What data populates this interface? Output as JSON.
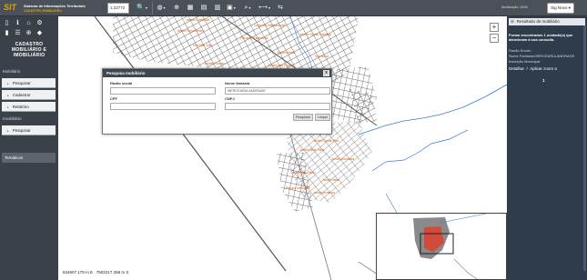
{
  "header": {
    "logo_mark": "SIT",
    "logo_line1": "Sistema de Informações Territoriais",
    "logo_line2": "CADASTRO MOBILIÁRIO",
    "scale": "1:22772",
    "last_update": "Atualização: 15/05",
    "sig_button": "Sig Novo"
  },
  "sidebar": {
    "title": "CADASTRO MOBILIÁRIO E IMOBILIÁRIO",
    "sections": [
      {
        "label": "Mobiliário",
        "items": [
          "Pesquisar",
          "Cadastrar",
          "Relatório"
        ]
      },
      {
        "label": "Imobiliário",
        "items": [
          "Pesquisar"
        ]
      }
    ],
    "tematicos": "Temáticos"
  },
  "dialog": {
    "title": "Pesquisa mobiliário",
    "close": "x",
    "labels": {
      "razao": "Razão social",
      "fantasia": "Nome fantasia",
      "cpf": "CPF",
      "cnpj": "CNPJ"
    },
    "values": {
      "razao": "",
      "fantasia": "MERCEARIA ANDRADE",
      "cpf": "",
      "cnpj": ""
    },
    "buttons": {
      "search": "Pesquisar",
      "clear": "Limpar"
    }
  },
  "map": {
    "coords_x": "634607.179 m E",
    "coords_y": "7502217.268 m S",
    "zoom_in": "+",
    "zoom_out": "−",
    "labels": [
      "Jardim Califórnia",
      "Conjunto Habitacional",
      "Jardim Rosa Muller",
      "Jardim Santa Cândida",
      "Parque Residencial",
      "Vila São José",
      "Jardim Brasil",
      "Vila Nova",
      "Jardim Paraíso",
      "Jardim das Flores",
      "Jardim Morumbi",
      "Jardim Santa Rita",
      "Jardim Bela Vista",
      "Jardim Alvorada",
      "Jardim São Paulo",
      "Jardim Itália",
      "Parque Industrial",
      "Jardim América"
    ],
    "colors": {
      "streets": "#6b6b6b",
      "labels": "#e05a00",
      "river": "#3a7bd5",
      "highlight": "#d24a3a"
    }
  },
  "results": {
    "title": "Resultado de mobiliário",
    "found": "Foram encontrados 1 unidade(s) que atenderam à sua consulta.",
    "razao": "Razão Social:",
    "fantasia": "Nome Fantasia:MERCEARIA ANDRADE",
    "inscricao": "Inscrição Municipal:",
    "detail": "Detalhar",
    "slash": "/",
    "zoom": "Aplicar zoom a",
    "page": "1"
  }
}
